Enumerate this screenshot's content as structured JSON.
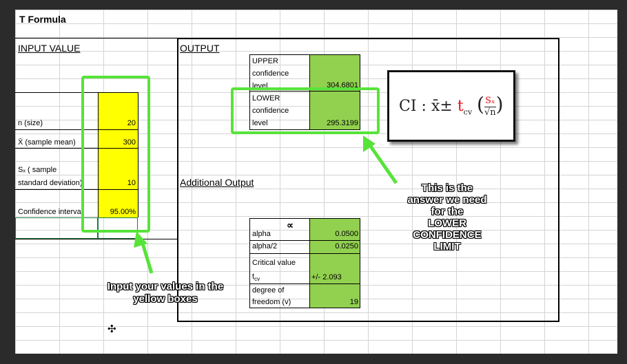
{
  "title": "T Formula",
  "input": {
    "header": "INPUT VALUE",
    "rows": [
      {
        "label": "n (size)",
        "value": "20"
      },
      {
        "label": "X̄ (sample mean)",
        "value": "300"
      },
      {
        "label_line1": "Sₓ ( sample",
        "label_line2": "standard deviation)",
        "value": "10"
      },
      {
        "label": "Confidence interval",
        "value": "95.00%"
      }
    ]
  },
  "output": {
    "header": "OUTPUT",
    "upper": {
      "line1": "UPPER",
      "line2": "confidence",
      "line3": "level",
      "value": "304.6801"
    },
    "lower": {
      "line1": "LOWER",
      "line2": "confidence",
      "line3": "level",
      "value": "295.3199"
    }
  },
  "additional": {
    "header": "Additional Output",
    "alpha_symbol": "∝",
    "rows": [
      {
        "label": "alpha",
        "value": "0.0500"
      },
      {
        "label": "alpha/2",
        "value": "0.0250"
      },
      {
        "label_line1": "Critical value",
        "label_line2": "t",
        "label_sub": "cv",
        "value": "+/- 2.093"
      },
      {
        "label_line1": "degree of",
        "label_line2": "freedom (v)",
        "value": "19"
      }
    ]
  },
  "formula": {
    "ci": "CI",
    "sep": ":",
    "xbar": "x̄",
    "pm": "±",
    "t": "t",
    "tsub": "cv",
    "num": "Sₓ",
    "den": "√n"
  },
  "callouts": {
    "input_note": "Input your values in the yellow boxes",
    "answer_note_1": "This is the",
    "answer_note_2": "answer we need",
    "answer_note_3": "for the",
    "answer_note_4": "LOWER",
    "answer_note_5": "CONFIDENCE",
    "answer_note_6": "LIMIT"
  },
  "colors": {
    "yellow": "#ffff00",
    "green": "#92d050",
    "highlight": "#57e33a"
  }
}
